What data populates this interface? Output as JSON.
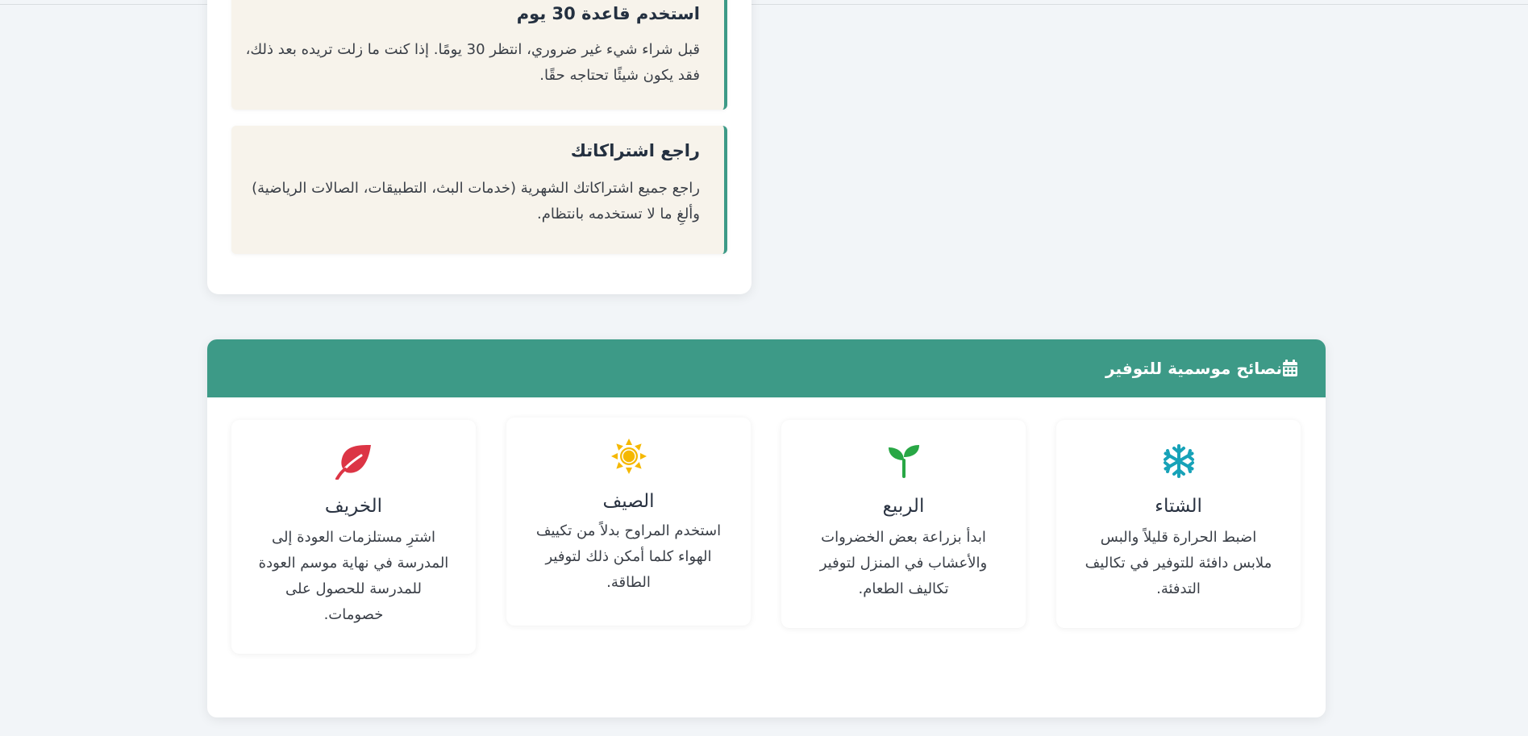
{
  "tips": [
    {
      "title": "استخدم قاعدة 30 يوم",
      "text": "قبل شراء شيء غير ضروري، انتظر 30 يومًا. إذا كنت ما زلت تريده بعد ذلك، فقد يكون شيئًا تحتاجه حقًا."
    },
    {
      "title": "راجع اشتراكاتك",
      "text": "راجع جميع اشتراكاتك الشهرية (خدمات البث، التطبيقات، الصالات الرياضية) وألغِ ما لا تستخدمه بانتظام."
    }
  ],
  "seasonal": {
    "title": "نصائح موسمية للتوفير",
    "header_icon": "calendar-icon",
    "header_color": "#3d9a87",
    "seasons": [
      {
        "name": "الشتاء",
        "icon": "snowflake-icon",
        "icon_color": "#17a2b8",
        "text": "اضبط الحرارة قليلاً والبس ملابس دافئة للتوفير في تكاليف التدفئة."
      },
      {
        "name": "الربيع",
        "icon": "seedling-icon",
        "icon_color": "#28a745",
        "text": "ابدأ بزراعة بعض الخضروات والأعشاب في المنزل لتوفير تكاليف الطعام."
      },
      {
        "name": "الصيف",
        "icon": "sun-icon",
        "icon_color": "#f5b800",
        "text": "استخدم المراوح بدلاً من تكييف الهواء كلما أمكن ذلك لتوفير الطاقة."
      },
      {
        "name": "الخريف",
        "icon": "leaf-icon",
        "icon_color": "#dc3545",
        "text": "اشترِ مستلزمات العودة إلى المدرسة في نهاية موسم العودة للمدرسة للحصول على خصومات."
      }
    ]
  }
}
